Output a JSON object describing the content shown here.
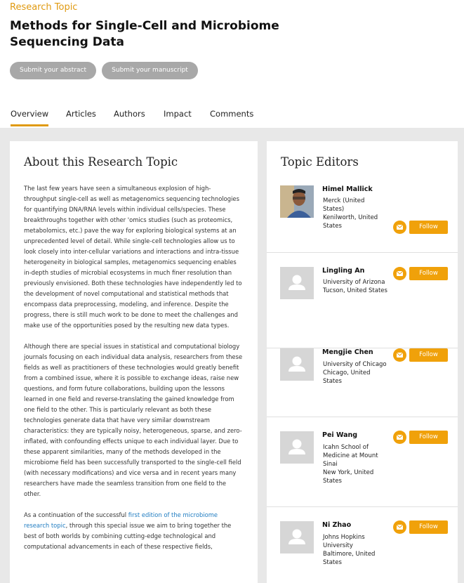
{
  "header": {
    "eyebrow": "Research Topic",
    "title_line1": "Methods for Single-Cell and Microbiome",
    "title_line2": "Sequencing Data",
    "submit_abstract": "Submit your abstract",
    "submit_manuscript": "Submit your manuscript"
  },
  "tabs": {
    "overview": "Overview",
    "articles": "Articles",
    "authors": "Authors",
    "impact": "Impact",
    "comments": "Comments",
    "active": "Overview"
  },
  "about": {
    "heading": "About this Research Topic",
    "p1": "The last few years have seen a simultaneous explosion of high-throughput single-cell as well as metagenomics sequencing technologies for quantifying DNA/RNA levels within individual cells/species. These breakthroughs together with other 'omics studies (such as proteomics, metabolomics, etc.) pave the way for exploring biological systems at an unprecedented level of detail. While single-cell technologies allow us to look closely into inter-cellular variations and interactions and intra-tissue heterogeneity in biological samples, metagenomics sequencing enables in-depth studies of microbial ecosystems in much finer resolution than previously envisioned. Both these technologies have independently led to the development of novel computational and statistical methods that encompass data preprocessing, modeling, and inference. Despite the progress, there is still much work to be done to meet the challenges and make use of the opportunities posed by the resulting new data types.",
    "p2": "Although there are special issues in statistical and computational biology journals focusing on each individual data analysis, researchers from these fields as well as practitioners of these technologies would greatly benefit from a combined issue, where it is possible to exchange ideas, raise new questions, and form future collaborations, building upon the lessons learned in one field and reverse-translating the gained knowledge from one field to the other. This is particularly relevant as both these technologies generate data that have very similar downstream characteristics: they are typically noisy, heterogeneous, sparse, and zero-inflated, with confounding effects unique to each individual layer. Due to these apparent similarities, many of the methods developed in the microbiome field has been successfully transported to the single-cell field (with necessary modifications) and vice versa and in recent years many researchers have made the seamless transition from one field to the other.",
    "p3_before": "As a continuation of the successful ",
    "p3_link": "first edition of the microbiome research topic",
    "p3_after": ", through this special issue we aim to bring together the best of both worlds by combining cutting-edge technological and computational advancements in each of these respective fields,"
  },
  "editors": {
    "heading": "Topic Editors",
    "follow_label": "Follow",
    "list": [
      {
        "name": "Himel Mallick",
        "affiliation": "Merck (United States)",
        "location": "Kenilworth, United States",
        "photo": "portrait"
      },
      {
        "name": "Lingling An",
        "affiliation": "University of Arizona",
        "location": "Tucson, United States",
        "photo": "placeholder"
      },
      {
        "name": "Mengjie Chen",
        "affiliation": "University of Chicago",
        "location": "Chicago, United States",
        "photo": "placeholder"
      },
      {
        "name": "Pei Wang",
        "affiliation": "Icahn School of Medicine at Mount Sinai",
        "location": "New York, United States",
        "photo": "placeholder"
      },
      {
        "name": "Ni Zhao",
        "affiliation": "Johns Hopkins University",
        "location": "Baltimore, United States",
        "photo": "placeholder"
      }
    ]
  },
  "colors": {
    "accent": "#f0a10a",
    "eyebrow": "#e09a11",
    "link": "#1f7cc1",
    "pill": "#a8a8a8",
    "page_bg": "#e8e8e8"
  },
  "icons": [
    "mail-icon",
    "user-placeholder-icon"
  ]
}
